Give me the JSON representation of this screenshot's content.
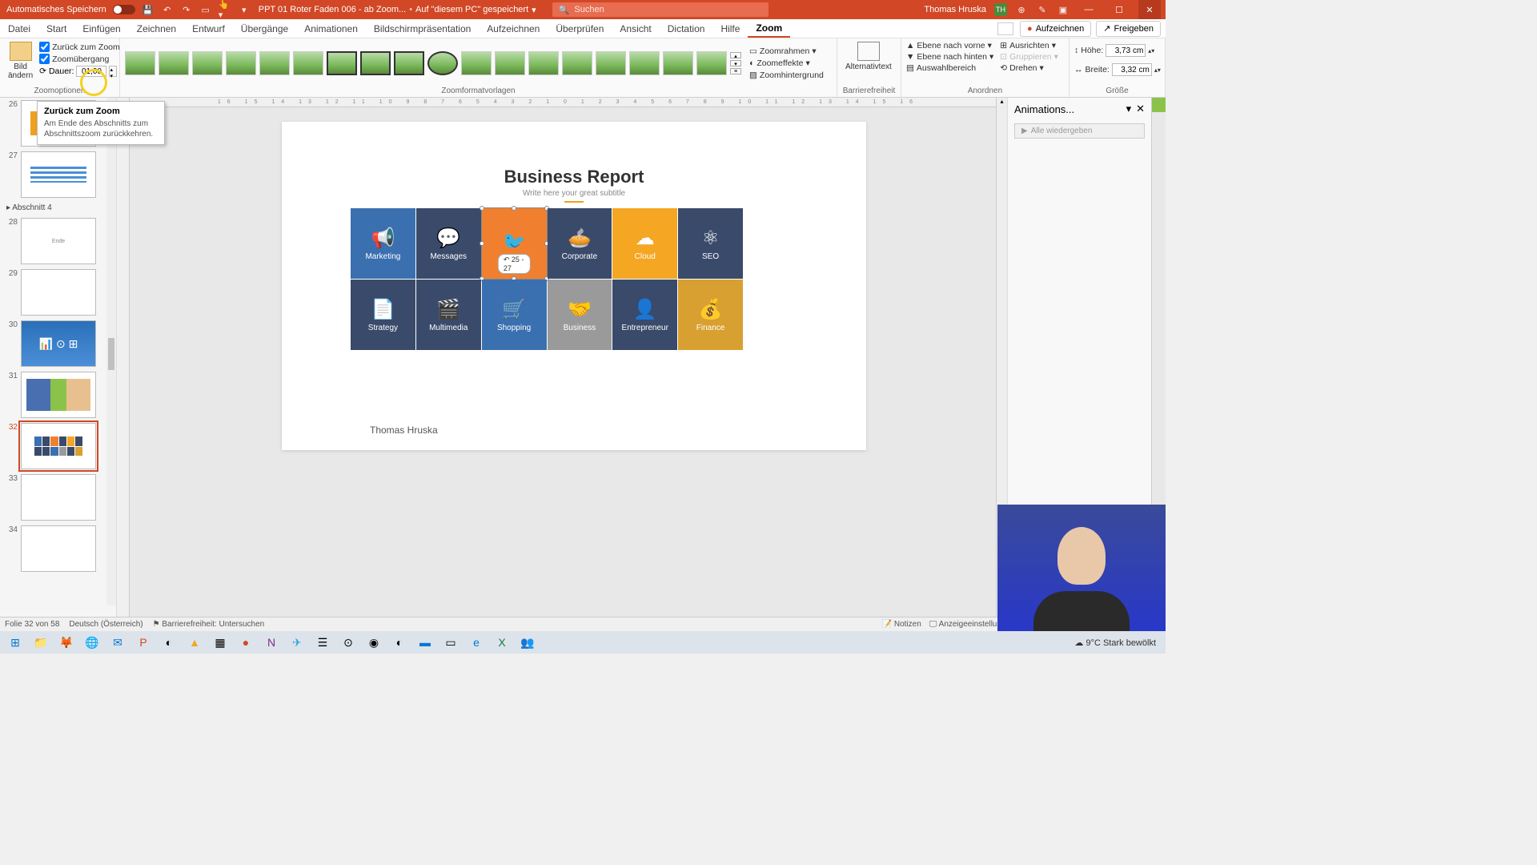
{
  "titlebar": {
    "autosave_label": "Automatisches Speichern",
    "doc_name": "PPT 01 Roter Faden 006 - ab Zoom...",
    "save_location": "Auf \"diesem PC\" gespeichert",
    "search_placeholder": "Suchen",
    "user_name": "Thomas Hruska",
    "user_initials": "TH"
  },
  "tabs": {
    "datei": "Datei",
    "start": "Start",
    "einfuegen": "Einfügen",
    "zeichnen": "Zeichnen",
    "entwurf": "Entwurf",
    "uebergaenge": "Übergänge",
    "animationen": "Animationen",
    "bildschirm": "Bildschirmpräsentation",
    "aufzeichnen_tab": "Aufzeichnen",
    "ueberpruefen": "Überprüfen",
    "ansicht": "Ansicht",
    "dictation": "Dictation",
    "hilfe": "Hilfe",
    "zoom": "Zoom",
    "aufzeichnen_btn": "Aufzeichnen",
    "freigeben_btn": "Freigeben"
  },
  "ribbon": {
    "bild_aendern": "Bild\nändern",
    "zurueck_zoom": "Zurück zum Zoom",
    "zoom_uebergang": "Zoomübergang",
    "dauer_label": "Dauer:",
    "dauer_value": "01,00",
    "group_zoomoptionen": "Zoomoptionen",
    "group_zoomformat": "Zoomformatvorlagen",
    "zoomrahmen": "Zoomrahmen",
    "zoomeffekte": "Zoomeffekte",
    "zoomhintergrund": "Zoomhintergrund",
    "alternativtext": "Alternativtext",
    "group_barrierefreiheit": "Barrierefreiheit",
    "ebene_vorne": "Ebene nach vorne",
    "ebene_hinten": "Ebene nach hinten",
    "auswahlbereich": "Auswahlbereich",
    "ausrichten": "Ausrichten",
    "gruppieren": "Gruppieren",
    "drehen": "Drehen",
    "group_anordnen": "Anordnen",
    "hoehe_label": "Höhe:",
    "hoehe_value": "3,73 cm",
    "breite_label": "Breite:",
    "breite_value": "3,32 cm",
    "group_groesse": "Größe"
  },
  "tooltip": {
    "title": "Zurück zum Zoom",
    "body": "Am Ende des Abschnitts zum Abschnittszoom zurückkehren."
  },
  "thumbs": {
    "section4": "Abschnitt 4",
    "slides": [
      {
        "n": "26"
      },
      {
        "n": "27"
      },
      {
        "n": "28",
        "txt": "Ende"
      },
      {
        "n": "29"
      },
      {
        "n": "30"
      },
      {
        "n": "31"
      },
      {
        "n": "32"
      },
      {
        "n": "33"
      },
      {
        "n": "34"
      }
    ]
  },
  "slide": {
    "title": "Business Report",
    "subtitle": "Write here your great subtitle",
    "author": "Thomas Hruska",
    "sel_bubble": "25 - 27",
    "tiles": [
      {
        "label": "Marketing",
        "bg": "#3a6fb0"
      },
      {
        "label": "Messages",
        "bg": "#3a4a6a"
      },
      {
        "label": "",
        "bg": "#f08030",
        "sel": true
      },
      {
        "label": "Corporate",
        "bg": "#3a4a6a"
      },
      {
        "label": "Cloud",
        "bg": "#f5a623"
      },
      {
        "label": "SEO",
        "bg": "#3a4a6a"
      },
      {
        "label": "Strategy",
        "bg": "#3a4a6a"
      },
      {
        "label": "Multimedia",
        "bg": "#3a4a6a"
      },
      {
        "label": "Shopping",
        "bg": "#3a6fb0"
      },
      {
        "label": "Business",
        "bg": "#9a9a9a"
      },
      {
        "label": "Entrepreneur",
        "bg": "#3a4a6a"
      },
      {
        "label": "Finance",
        "bg": "#d8a030"
      }
    ]
  },
  "anim": {
    "title": "Animations...",
    "play_all": "Alle wiedergeben"
  },
  "status": {
    "slide_pos": "Folie 32 von 58",
    "lang": "Deutsch (Österreich)",
    "access": "Barrierefreiheit: Untersuchen",
    "notizen": "Notizen",
    "anzeige": "Anzeigeeinstellungen"
  },
  "taskbar": {
    "weather": "9°C  Stark bewölkt"
  },
  "ruler_h": "16 15 14 13 12 11 10 9 8 7 6 5 4 3 2 1 0 1 2 3 4 5 6 7 8 9 10 11 12 13 14 15 16"
}
